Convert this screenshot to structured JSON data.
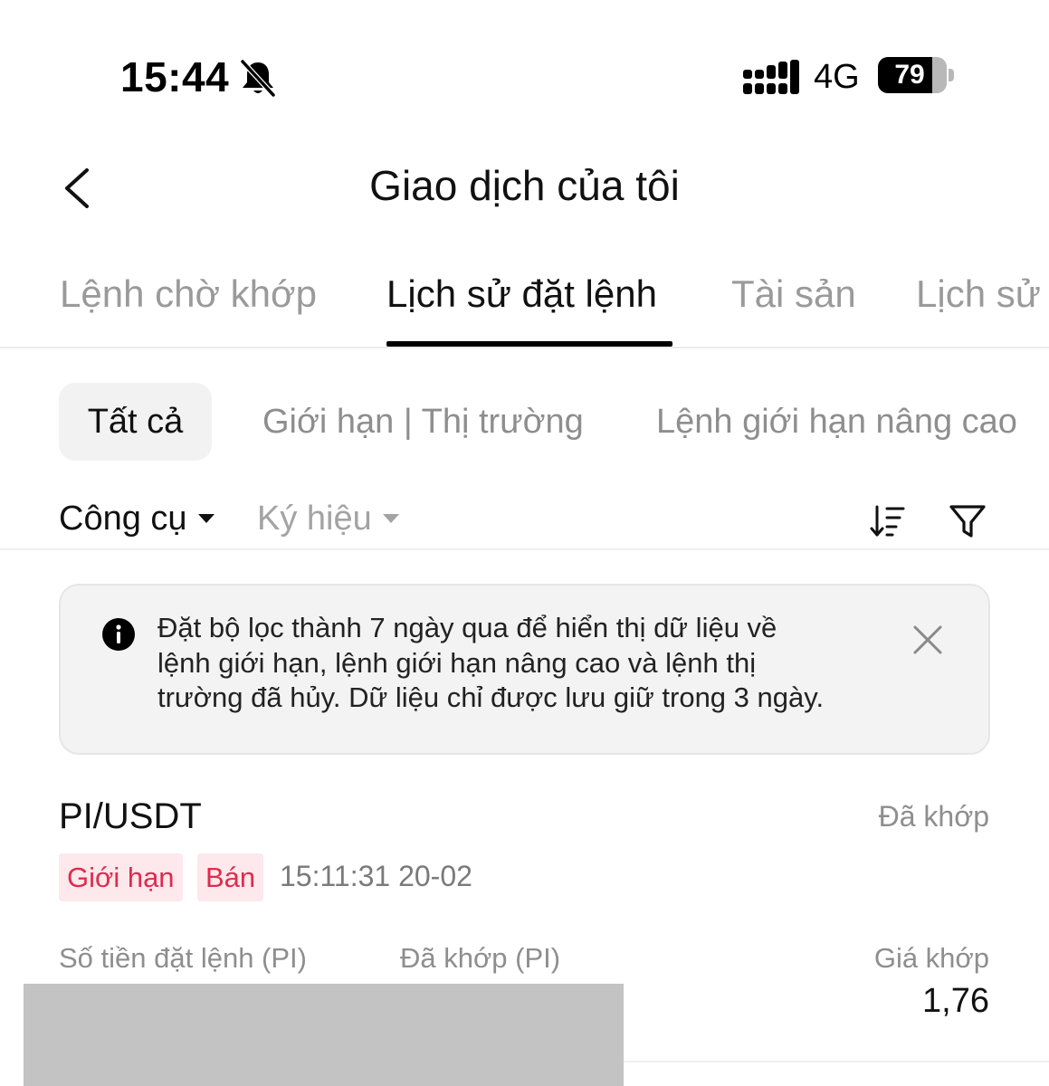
{
  "status_bar": {
    "time": "15:44",
    "network": "4G",
    "battery": "79",
    "battery_level": 0.79,
    "icons": [
      "bell-slash-icon",
      "signal-icon"
    ]
  },
  "header": {
    "title": "Giao dịch của tôi",
    "back_icon": "chevron-left-icon"
  },
  "tabs": [
    {
      "label": "Lệnh chờ khớp",
      "active": false
    },
    {
      "label": "Lịch sử đặt lệnh",
      "active": true
    },
    {
      "label": "Tài sản",
      "active": false
    },
    {
      "label": "Lịch sử",
      "active": false
    }
  ],
  "filters": {
    "all": "Tất cả",
    "limit_market": "Giới hạn | Thị trường",
    "advanced_limit": "Lệnh giới hạn nâng cao"
  },
  "tools": {
    "instrument": "Công cụ",
    "symbol": "Ký hiệu",
    "icons": [
      "sort-icon",
      "filter-icon"
    ]
  },
  "notice": {
    "lines": [
      "Đặt bộ lọc thành 7 ngày qua để hiển thị dữ liệu về",
      "lệnh giới hạn, lệnh giới hạn nâng cao và lệnh thị",
      "trường đã hủy. Dữ liệu chỉ được lưu giữ trong 3 ngày."
    ]
  },
  "order": {
    "pair": "PI/USDT",
    "status": "Đã khớp",
    "type_tag": "Giới hạn",
    "side_tag": "Bán",
    "time": "15:11:31 20-02",
    "columns": {
      "order_amount": "Số tiền đặt lệnh (PI)",
      "filled": "Đã khớp (PI)",
      "match_price": "Giá khớp"
    },
    "match_price_value": "1,76"
  },
  "colors": {
    "sell_tag_bg": "#fde8ec",
    "sell_tag_text": "#dd2c4d",
    "muted_text": "#8e8e8e",
    "redaction": "#c3c3c3"
  }
}
